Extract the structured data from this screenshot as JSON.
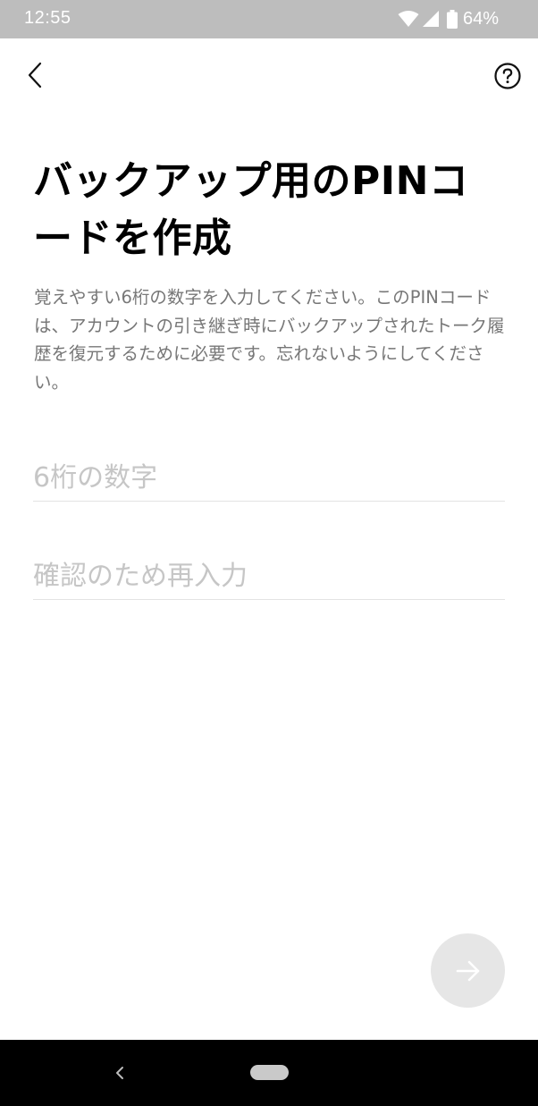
{
  "status_bar": {
    "time": "12:55",
    "battery": "64%",
    "icons": [
      "wifi-icon",
      "cell-signal-icon",
      "battery-icon"
    ]
  },
  "header": {
    "back_icon": "chevron-left-icon",
    "help_icon": "question-circle-icon"
  },
  "main": {
    "title": "バックアップ用のPINコードを作成",
    "description": "覚えやすい6桁の数字を入力してください。このPINコードは、アカウントの引き継ぎ時にバックアップされたトーク履歴を復元するために必要です。忘れないようにしてください。",
    "pin_input": {
      "value": "",
      "placeholder": "6桁の数字"
    },
    "confirm_input": {
      "value": "",
      "placeholder": "確認のため再入力"
    },
    "next_icon": "arrow-right-icon"
  },
  "colors": {
    "status_bar_bg": "#bdbdbd",
    "title": "#000000",
    "description": "#777777",
    "placeholder": "#c6c6c6",
    "next_button_bg": "#e6e6e6",
    "nav_bar_bg": "#000000"
  }
}
